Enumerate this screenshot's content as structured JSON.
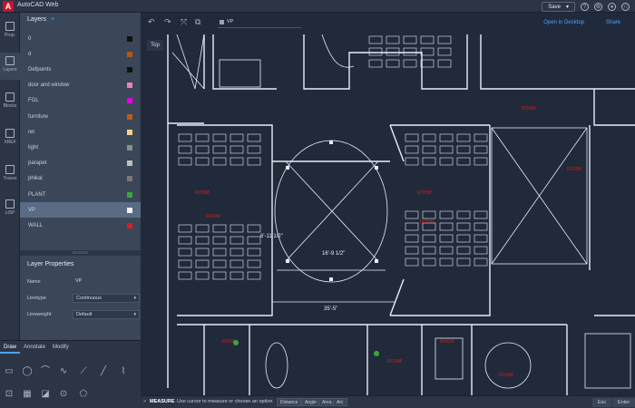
{
  "app": {
    "title": "AutoCAD Web",
    "logo": "A",
    "save_label": "Save",
    "save_caret": "▾"
  },
  "rail": [
    {
      "label": "Prop.",
      "icon": "properties-icon"
    },
    {
      "label": "Layers",
      "icon": "layers-icon",
      "active": true
    },
    {
      "label": "Blocks",
      "icon": "blocks-icon"
    },
    {
      "label": "XREF",
      "icon": "xref-icon"
    },
    {
      "label": "Traces",
      "icon": "traces-icon"
    },
    {
      "label": "LISP",
      "icon": "lisp-icon"
    }
  ],
  "layers_panel": {
    "title": "Layers",
    "plus": "+",
    "layers": [
      {
        "name": "0",
        "color": "#111111"
      },
      {
        "name": "d",
        "color": "#b8560f"
      },
      {
        "name": "Defpoints",
        "color": "#111111"
      },
      {
        "name": "door and window",
        "color": "#f07fb8"
      },
      {
        "name": "FGL",
        "color": "#e600e6"
      },
      {
        "name": "furniture",
        "color": "#c45a12"
      },
      {
        "name": "ret",
        "color": "#f0d28a"
      },
      {
        "name": "light",
        "color": "#8c8c8c"
      },
      {
        "name": "parapet",
        "color": "#bfbfbf"
      },
      {
        "name": "phikal",
        "color": "#7a7a7a"
      },
      {
        "name": "PLANT",
        "color": "#3aa63a"
      },
      {
        "name": "VP",
        "color": "#f0f0f0",
        "selected": true
      },
      {
        "name": "WALL",
        "color": "#e01b1b"
      }
    ]
  },
  "grip": "≡≡≡≡≡≡",
  "layer_props": {
    "title": "Layer Properties",
    "name_label": "Name",
    "name_value": "VP",
    "linetype_label": "Linetype",
    "linetype_value": "Continuous",
    "lineweight_label": "Lineweight",
    "lineweight_value": "Default"
  },
  "tools": {
    "tabs": [
      "Draw",
      "Annotate",
      "Modify"
    ]
  },
  "canvas": {
    "layer_selector": "VP",
    "open_desktop": "Open in Desktop",
    "share": "Share",
    "view_label": "Top",
    "dims": [
      "6'-11 1/2\"",
      "16'-9 1/2\"",
      "35'-5\""
    ],
    "room_labels": [
      "ROOM",
      "ROOM",
      "ROOM",
      "ROOM",
      "ROOM",
      "ROOM",
      "ROOM",
      "ROOM",
      "ROOM",
      "ROOM"
    ]
  },
  "command": {
    "caret": ">",
    "strong": "MEASURE",
    "text": "Use cursor to measure or choose an option",
    "options": [
      "Distance",
      "Angle",
      "Area",
      "Arc"
    ],
    "right_buttons": [
      "Esc",
      "Enter"
    ]
  },
  "colors": {
    "accent": "#4aa3ff",
    "brand": "#c8102e",
    "line": "#e8eef8",
    "red": "#e01b1b"
  }
}
